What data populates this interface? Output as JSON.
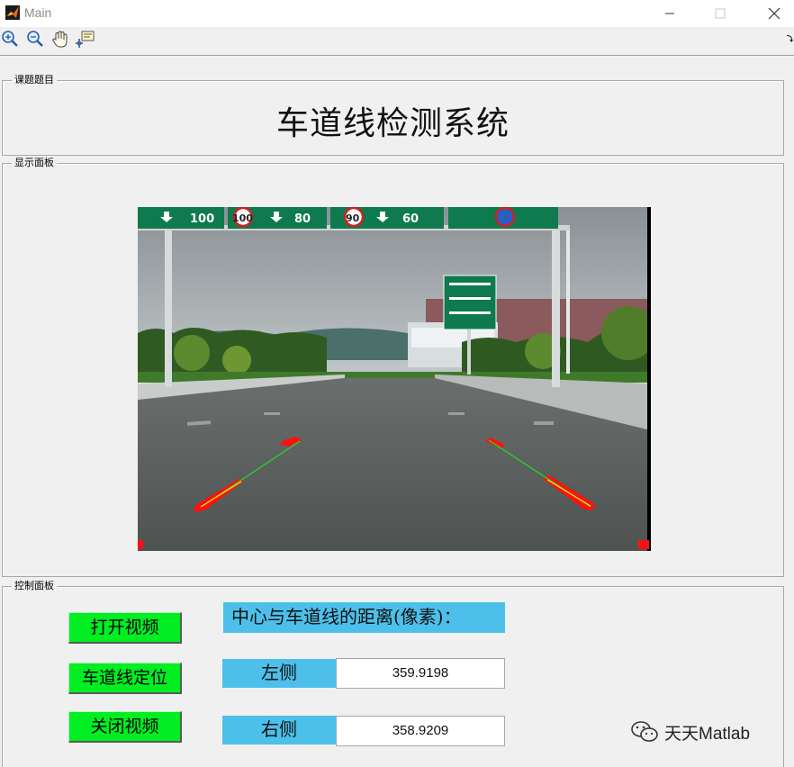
{
  "window": {
    "title": "Main"
  },
  "toolbar": {
    "tools": [
      "zoom-in-icon",
      "zoom-out-icon",
      "pan-hand-icon",
      "data-cursor-icon"
    ]
  },
  "panels": {
    "topic": {
      "label": "课题题目",
      "title": "车道线检测系统"
    },
    "display": {
      "label": "显示面板"
    },
    "control": {
      "label": "控制面板",
      "buttons": {
        "open_video": "打开视频",
        "locate_lane": "车道线定位",
        "close_video": "关闭视频"
      },
      "distance_heading": "中心与车道线的距离(像素)：",
      "left_label": "左侧",
      "left_value": "359.9198",
      "right_label": "右侧",
      "right_value": "358.9209"
    }
  },
  "video": {
    "signs": [
      "100",
      "100",
      "80",
      "90",
      "60"
    ]
  },
  "watermark": {
    "text": "天天Matlab"
  },
  "colors": {
    "button_green": "#00ee22",
    "label_blue": "#4cc0ea",
    "lane_red": "#ff1010",
    "fit_line_green": "#22dd22"
  }
}
